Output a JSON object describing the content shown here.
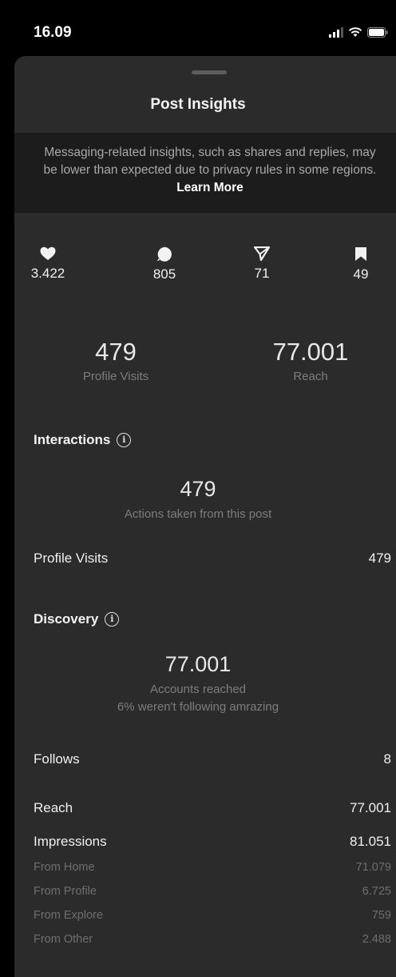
{
  "status_bar": {
    "time": "16.09"
  },
  "sheet": {
    "title": "Post Insights",
    "notice": {
      "text": "Messaging-related insights, such as shares and replies, may be lower than expected due to privacy rules in some regions.",
      "link": "Learn More"
    }
  },
  "stats": {
    "likes": {
      "icon": "heart-icon",
      "value": "3.422"
    },
    "comments": {
      "icon": "comment-icon",
      "value": "805"
    },
    "shares": {
      "icon": "send-icon",
      "value": "71"
    },
    "saves": {
      "icon": "bookmark-icon",
      "value": "49"
    }
  },
  "summary": {
    "profile_visits": {
      "value": "479",
      "label": "Profile Visits"
    },
    "reach": {
      "value": "77.001",
      "label": "Reach"
    }
  },
  "interactions": {
    "title": "Interactions",
    "total": "479",
    "total_label": "Actions taken from this post",
    "rows": [
      {
        "label": "Profile Visits",
        "value": "479"
      }
    ]
  },
  "discovery": {
    "title": "Discovery",
    "total": "77.001",
    "total_label": "Accounts reached",
    "total_sub": "6% weren't following amrazing",
    "follows": {
      "label": "Follows",
      "value": "8"
    },
    "reach": {
      "label": "Reach",
      "value": "77.001"
    },
    "impressions": {
      "label": "Impressions",
      "value": "81.051"
    },
    "sources": [
      {
        "label": "From Home",
        "value": "71.079"
      },
      {
        "label": "From Profile",
        "value": "6.725"
      },
      {
        "label": "From Explore",
        "value": "759"
      },
      {
        "label": "From Other",
        "value": "2.488"
      }
    ]
  }
}
